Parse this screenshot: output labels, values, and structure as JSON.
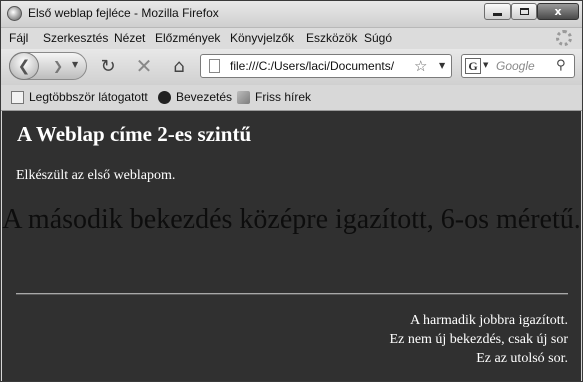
{
  "window": {
    "title": "Első weblap fejléce - Mozilla Firefox",
    "close_glyph": "x"
  },
  "menu": {
    "items": [
      "Fájl",
      "Szerkesztés",
      "Nézet",
      "Előzmények",
      "Könyvjelzők",
      "Eszközök",
      "Súgó"
    ]
  },
  "toolbar": {
    "url": "file:///C:/Users/laci/Documents/",
    "search_engine": "G",
    "search_placeholder": "Google"
  },
  "bookmarks": {
    "items": [
      "Legtöbbször látogatott",
      "Bevezetés",
      "Friss hírek"
    ]
  },
  "page": {
    "heading": "A Weblap címe 2-es szintű",
    "paragraph1": "Elkészült az első weblapom.",
    "paragraph2": "A második bekezdés középre igazított, 6-os méretű.",
    "right_lines": [
      "A harmadik jobbra igazított.",
      "Ez nem új bekezdés, csak új sor",
      "Ez az utolsó sor."
    ]
  },
  "colors": {
    "content_background": "#303030",
    "content_text": "#ffffff",
    "centered_text": "#0d0d0d"
  }
}
